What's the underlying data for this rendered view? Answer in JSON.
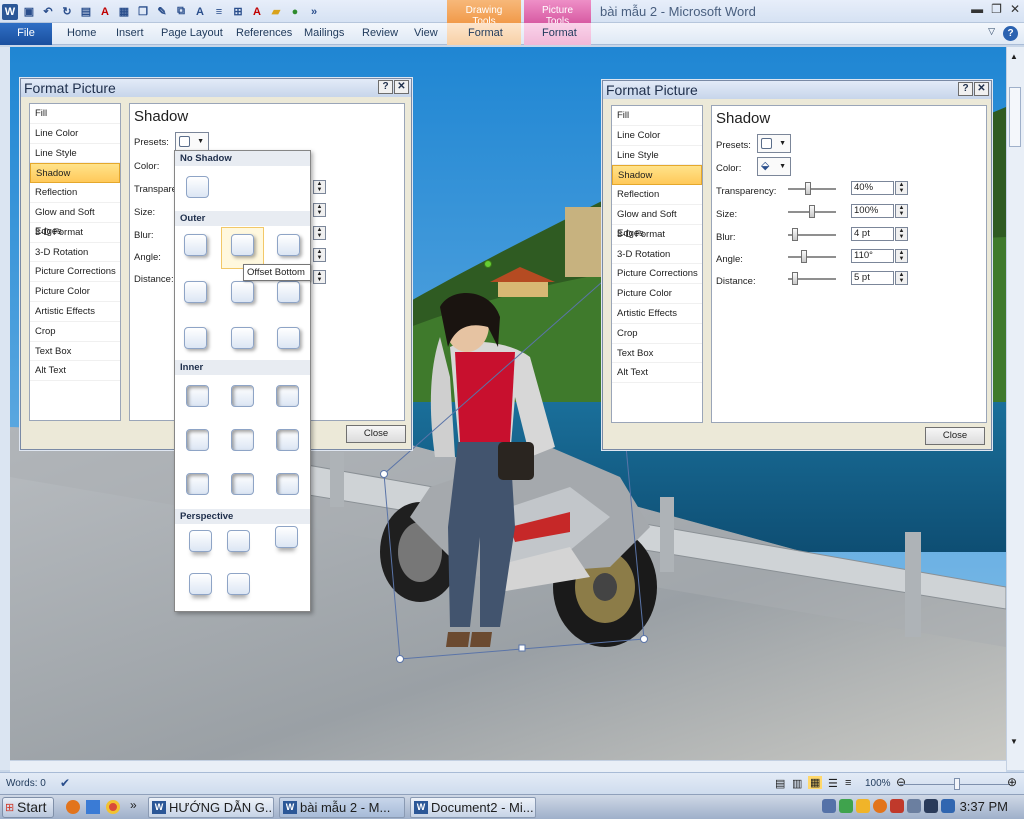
{
  "window": {
    "title": "bài mẫu 2 - Microsoft Word",
    "contextual_tabs": [
      {
        "group": "Drawing Tools",
        "tab": "Format",
        "color": "#f19a4a"
      },
      {
        "group": "Picture Tools",
        "tab": "Format",
        "color": "#d85ba3"
      }
    ]
  },
  "ribbon": {
    "file": "File",
    "tabs": [
      "Home",
      "Insert",
      "Page Layout",
      "References",
      "Mailings",
      "Review",
      "View"
    ]
  },
  "dialog_left": {
    "title": "Format Picture",
    "categories": [
      "Fill",
      "Line Color",
      "Line Style",
      "Shadow",
      "Reflection",
      "Glow and Soft Edges",
      "3-D Format",
      "3-D Rotation",
      "Picture Corrections",
      "Picture Color",
      "Artistic Effects",
      "Crop",
      "Text Box",
      "Alt Text"
    ],
    "selected": "Shadow",
    "panel_title": "Shadow",
    "labels": {
      "presets": "Presets:",
      "color": "Color:",
      "transparency": "Transpare",
      "size": "Size:",
      "blur": "Blur:",
      "angle": "Angle:",
      "distance": "Distance:"
    },
    "close": "Close"
  },
  "presets_popup": {
    "no_shadow": "No Shadow",
    "outer": "Outer",
    "inner": "Inner",
    "perspective": "Perspective",
    "tooltip": "Offset Bottom"
  },
  "dialog_right": {
    "title": "Format Picture",
    "categories": [
      "Fill",
      "Line Color",
      "Line Style",
      "Shadow",
      "Reflection",
      "Glow and Soft Edges",
      "3-D Format",
      "3-D Rotation",
      "Picture Corrections",
      "Picture Color",
      "Artistic Effects",
      "Crop",
      "Text Box",
      "Alt Text"
    ],
    "selected": "Shadow",
    "panel_title": "Shadow",
    "labels": {
      "presets": "Presets:",
      "color": "Color:",
      "transparency": "Transparency:",
      "size": "Size:",
      "blur": "Blur:",
      "angle": "Angle:",
      "distance": "Distance:"
    },
    "values": {
      "transparency": "40%",
      "size": "100%",
      "blur": "4 pt",
      "angle": "110°",
      "distance": "5 pt"
    },
    "slider_levels": {
      "transparency": 0.4,
      "size": 0.5,
      "blur": 0.1,
      "angle": 0.3,
      "distance": 0.1
    },
    "close": "Close"
  },
  "statusbar": {
    "words": "Words: 0",
    "zoom": "100%"
  },
  "taskbar": {
    "start": "Start",
    "tasks": [
      "HƯỚNG DẪN G...",
      "bài mẫu 2 - M...",
      "Document2 - Mi..."
    ],
    "clock": "3:37 PM"
  }
}
